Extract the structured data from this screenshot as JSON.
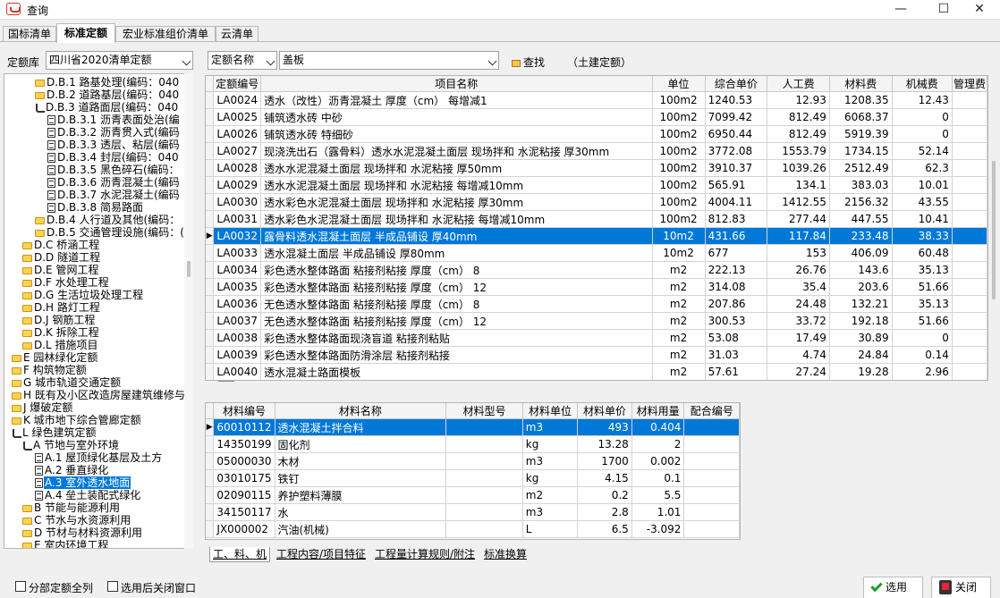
{
  "title": "查询",
  "window_controls": {
    "minimize": "—",
    "maximize": "☐",
    "close": "✕"
  },
  "tabs": [
    "国标清单",
    "标准定额",
    "宏业标准组价清单",
    "云清单"
  ],
  "active_tab": 1,
  "toolbar": {
    "lib_label": "定额库",
    "lib_value": "四川省2020清单定额",
    "field_value": "定额名称",
    "search_value": "盖板",
    "search_btn": "查找",
    "category": "（土建定额）"
  },
  "tree": [
    {
      "t": "D.B.1 路基处理(编码：040",
      "i": "folder",
      "lv": 3
    },
    {
      "t": "D.B.2 道路基层(编码：040",
      "i": "folder",
      "lv": 3
    },
    {
      "t": "D.B.3 道路面层(编码：040",
      "i": "open",
      "lv": 3
    },
    {
      "t": "D.B.3.1 沥青表面处治(编",
      "i": "doc",
      "lv": 4
    },
    {
      "t": "D.B.3.2 沥青贯入式(编码",
      "i": "doc",
      "lv": 4
    },
    {
      "t": "D.B.3.3 透层、粘层(编码",
      "i": "doc",
      "lv": 4
    },
    {
      "t": "D.B.3.4 封层(编码：040",
      "i": "doc",
      "lv": 4
    },
    {
      "t": "D.B.3.5 黑色碎石(编码：",
      "i": "doc",
      "lv": 4
    },
    {
      "t": "D.B.3.6 沥青混凝土(编码",
      "i": "doc",
      "lv": 4
    },
    {
      "t": "D.B.3.7 水泥混凝土(编码",
      "i": "doc",
      "lv": 4
    },
    {
      "t": "D.B.3.8 简易路面",
      "i": "doc",
      "lv": 4
    },
    {
      "t": "D.B.4 人行道及其他(编码：",
      "i": "folder",
      "lv": 3
    },
    {
      "t": "D.B.5 交通管理设施(编码：(",
      "i": "folder",
      "lv": 3
    },
    {
      "t": "D.C 桥涵工程",
      "i": "folder",
      "lv": 2
    },
    {
      "t": "D.D 隧道工程",
      "i": "folder",
      "lv": 2
    },
    {
      "t": "D.E 管网工程",
      "i": "folder",
      "lv": 2
    },
    {
      "t": "D.F 水处理工程",
      "i": "folder",
      "lv": 2
    },
    {
      "t": "D.G 生活垃圾处理工程",
      "i": "folder",
      "lv": 2
    },
    {
      "t": "D.H 路灯工程",
      "i": "folder",
      "lv": 2
    },
    {
      "t": "D.J 钢筋工程",
      "i": "folder",
      "lv": 2
    },
    {
      "t": "D.K 拆除工程",
      "i": "folder",
      "lv": 2
    },
    {
      "t": "D.L 措施项目",
      "i": "folder",
      "lv": 2
    },
    {
      "t": "E 园林绿化定额",
      "i": "folder",
      "lv": 1
    },
    {
      "t": "F 构筑物定额",
      "i": "folder",
      "lv": 1
    },
    {
      "t": "G 城市轨道交通定额",
      "i": "folder",
      "lv": 1
    },
    {
      "t": "H 既有及小区改造房屋建筑维修与",
      "i": "folder",
      "lv": 1
    },
    {
      "t": "J 爆破定额",
      "i": "folder",
      "lv": 1
    },
    {
      "t": "K 城市地下综合管廊定额",
      "i": "folder",
      "lv": 1
    },
    {
      "t": "L 绿色建筑定额",
      "i": "open",
      "lv": 1
    },
    {
      "t": "A 节地与室外环境",
      "i": "open",
      "lv": 2
    },
    {
      "t": "A.1 屋顶绿化基层及土方",
      "i": "doc",
      "lv": 3
    },
    {
      "t": "A.2 垂直绿化",
      "i": "doc",
      "lv": 3
    },
    {
      "t": "A.3 室外透水地面",
      "i": "doc",
      "lv": 3,
      "sel": true
    },
    {
      "t": "A.4 垒土装配式绿化",
      "i": "doc",
      "lv": 3
    },
    {
      "t": "B 节能与能源利用",
      "i": "folder",
      "lv": 2
    },
    {
      "t": "C 节水与水资源利用",
      "i": "folder",
      "lv": 2
    },
    {
      "t": "D 节材与材料资源利用",
      "i": "folder",
      "lv": 2
    },
    {
      "t": "E 室内环境工程",
      "i": "folder",
      "lv": 2
    }
  ],
  "quota_cols": [
    "定额编号",
    "项目名称",
    "单位",
    "综合单价",
    "人工费",
    "材料费",
    "机械费",
    "管理费"
  ],
  "quota_rows": [
    [
      "LA0024",
      "透水（改性）沥青混凝土 厚度（cm） 每增减1",
      "100m2",
      "1240.53",
      "12.93",
      "1208.35",
      "12.43"
    ],
    [
      "LA0025",
      "铺筑透水砖 中砂",
      "100m2",
      "7099.42",
      "812.49",
      "6068.37",
      "0"
    ],
    [
      "LA0026",
      "铺筑透水砖 特细砂",
      "100m2",
      "6950.44",
      "812.49",
      "5919.39",
      "0"
    ],
    [
      "LA0027",
      "现浇洗出石（露骨料）透水水泥混凝土面层 现场拌和 水泥粘接 厚30mm",
      "100m2",
      "3772.08",
      "1553.79",
      "1734.15",
      "52.14"
    ],
    [
      "LA0028",
      "透水水泥混凝土面层 现场拌和 水泥粘接 厚50mm",
      "100m2",
      "3910.37",
      "1039.26",
      "2512.49",
      "62.3"
    ],
    [
      "LA0029",
      "透水水泥混凝土面层 现场拌和 水泥粘接 每增减10mm",
      "100m2",
      "565.91",
      "134.1",
      "383.03",
      "10.01"
    ],
    [
      "LA0030",
      "透水彩色水泥混凝土面层 现场拌和 水泥粘接 厚30mm",
      "100m2",
      "4004.11",
      "1412.55",
      "2156.32",
      "43.55"
    ],
    [
      "LA0031",
      "透水彩色水泥混凝土面层 现场拌和 水泥粘接 每增减10mm",
      "100m2",
      "812.83",
      "277.44",
      "447.55",
      "10.41"
    ],
    [
      "LA0032",
      "露骨料透水混凝土面层 半成品铺设 厚40mm",
      "10m2",
      "431.66",
      "117.84",
      "233.48",
      "38.33"
    ],
    [
      "LA0033",
      "透水混凝土面层 半成品铺设 厚80mm",
      "10m2",
      "677",
      "153",
      "406.09",
      "60.48"
    ],
    [
      "LA0034",
      "彩色透水整体路面 粘接剂粘接 厚度（cm） 8",
      "m2",
      "222.13",
      "26.76",
      "143.6",
      "35.13"
    ],
    [
      "LA0035",
      "彩色透水整体路面 粘接剂粘接 厚度（cm） 12",
      "m2",
      "314.08",
      "35.4",
      "203.6",
      "51.66"
    ],
    [
      "LA0036",
      "无色透水整体路面 粘接剂粘接 厚度（cm） 8",
      "m2",
      "207.86",
      "24.48",
      "132.21",
      "35.13"
    ],
    [
      "LA0037",
      "无色透水整体路面 粘接剂粘接 厚度（cm） 12",
      "m2",
      "300.53",
      "33.72",
      "192.18",
      "51.66"
    ],
    [
      "LA0038",
      "彩色透水整体路面现浇盲道 粘接剂粘贴",
      "m2",
      "53.08",
      "17.49",
      "30.89",
      "0"
    ],
    [
      "LA0039",
      "彩色透水整体路面防滑涂层 粘接剂粘接",
      "m2",
      "31.03",
      "4.74",
      "24.84",
      "0.14"
    ],
    [
      "LA0040",
      "透水混凝土路面模板",
      "m2",
      "57.61",
      "27.24",
      "19.28",
      "2.96"
    ]
  ],
  "quota_selected": 8,
  "mat_cols": [
    "材料编号",
    "材料名称",
    "材料型号",
    "材料单位",
    "材料单价",
    "材料用量",
    "配合编号"
  ],
  "mat_rows": [
    [
      "60010112",
      "透水混凝土拌合料",
      "",
      "m3",
      "493",
      "0.404",
      ""
    ],
    [
      "14350199",
      "固化剂",
      "",
      "kg",
      "13.28",
      "2",
      ""
    ],
    [
      "05000030",
      "木材",
      "",
      "m3",
      "1700",
      "0.002",
      ""
    ],
    [
      "03010175",
      "铁钉",
      "",
      "kg",
      "4.15",
      "0.1",
      ""
    ],
    [
      "02090115",
      "养护塑料薄膜",
      "",
      "m2",
      "0.2",
      "5.5",
      ""
    ],
    [
      "34150117",
      "水",
      "",
      "m3",
      "2.8",
      "1.01",
      ""
    ],
    [
      "JX000002",
      "汽油(机械)",
      "",
      "L",
      "6.5",
      "-3.092",
      ""
    ]
  ],
  "bottom_tabs": [
    "工、料、机",
    "工程内容/项目特征",
    "工程量计算规则/附注",
    "标准换算"
  ],
  "options": {
    "show_all": "分部定额全列",
    "close_after": "选用后关闭窗口"
  },
  "buttons": {
    "select": "选用",
    "close": "关闭"
  }
}
